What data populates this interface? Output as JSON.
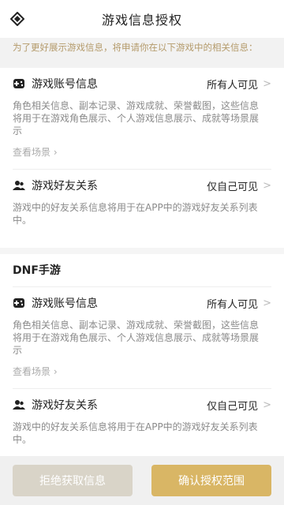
{
  "header": {
    "title": "游戏信息授权",
    "back_icon": "diamond-back-icon"
  },
  "notice": {
    "text": "为了更好展示游戏信息，将申请你在以下游戏中的相关信息："
  },
  "games": [
    {
      "name": "",
      "permissions": [
        {
          "icon": "controller-icon",
          "title": "游戏账号信息",
          "visibility": "所有人可见",
          "desc": "角色相关信息、副本记录、游戏成就、荣誉截图，这些信息将用于在游戏角色展示、个人游戏信息展示、成就等场景展示",
          "link": "查看场景 ›"
        },
        {
          "icon": "friends-icon",
          "title": "游戏好友关系",
          "visibility": "仅自己可见",
          "desc": "游戏中的好友关系信息将用于在APP中的游戏好友关系列表中。",
          "link": ""
        }
      ]
    },
    {
      "name": "DNF手游",
      "permissions": [
        {
          "icon": "controller-icon",
          "title": "游戏账号信息",
          "visibility": "所有人可见",
          "desc": "角色相关信息、副本记录、游戏成就、荣誉截图，这些信息将用于在游戏角色展示、个人游戏信息展示、成就等场景展示",
          "link": "查看场景 ›"
        },
        {
          "icon": "friends-icon",
          "title": "游戏好友关系",
          "visibility": "仅自己可见",
          "desc": "游戏中的好友关系信息将用于在APP中的游戏好友关系列表中。",
          "link": ""
        }
      ]
    }
  ],
  "footer": {
    "reject_label": "拒绝获取信息",
    "confirm_label": "确认授权范围"
  },
  "colors": {
    "accent": "#d9b665",
    "notice": "#b49a6a",
    "reject": "#d9d4c8"
  }
}
